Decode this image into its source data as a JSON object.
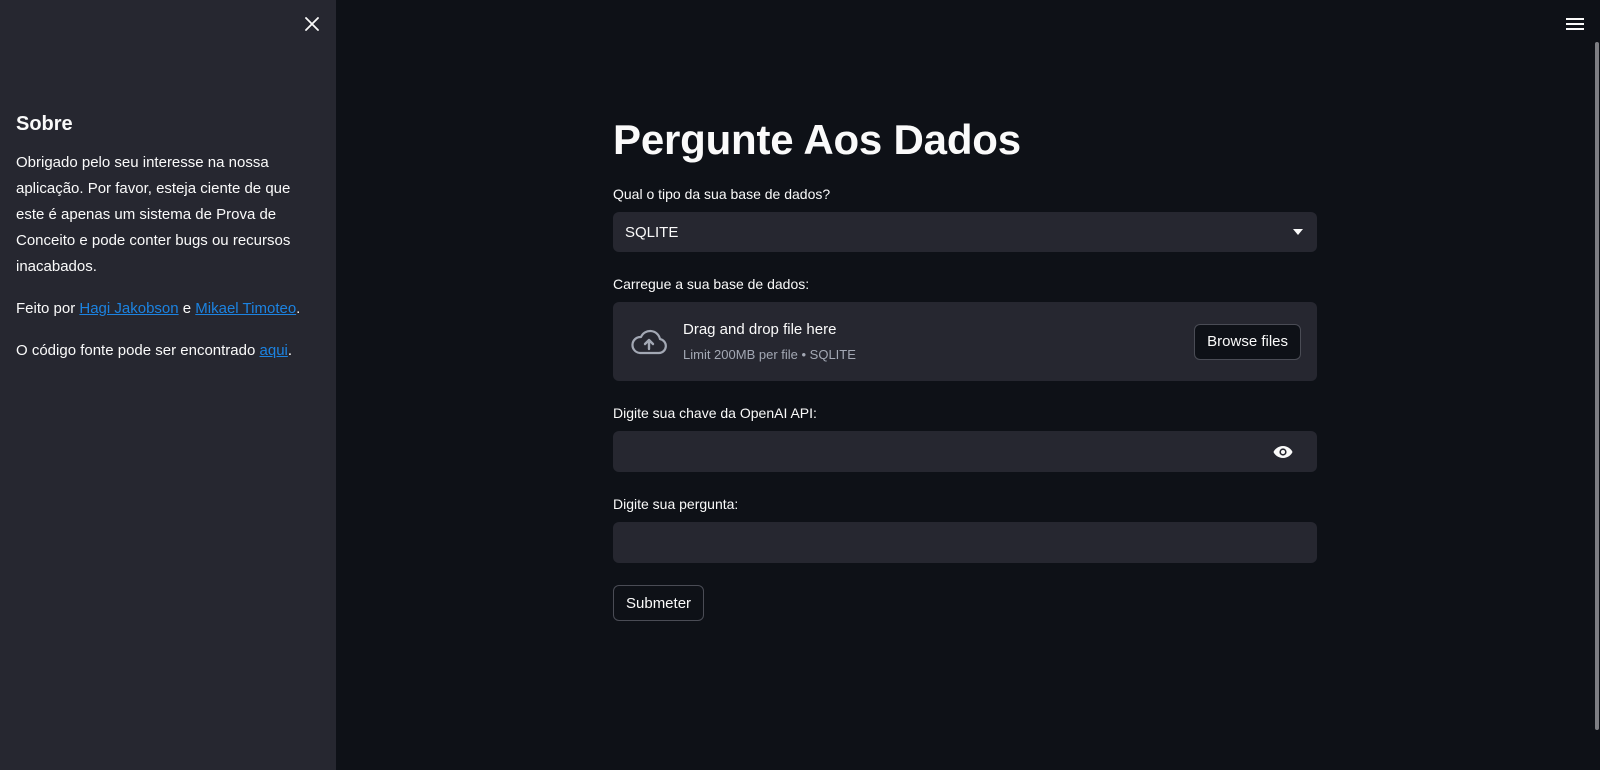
{
  "sidebar": {
    "close_icon": "close-icon",
    "heading": "Sobre",
    "paragraph1": "Obrigado pelo seu interesse na nossa aplicação. Por favor, esteja ciente de que este é apenas um sistema de Prova de Conceito e pode conter bugs ou recursos inacabados.",
    "made_by_prefix": "Feito por ",
    "author1": "Hagi Jakobson",
    "made_by_joiner": " e ",
    "author2": "Mikael Timoteo",
    "made_by_suffix": ".",
    "source_prefix": "O código fonte pode ser encontrado ",
    "source_link": "aqui",
    "source_suffix": "."
  },
  "header": {
    "menu_icon": "hamburger-menu-icon"
  },
  "main": {
    "title": "Pergunte Aos Dados",
    "db_type": {
      "label": "Qual o tipo da sua base de dados?",
      "selected": "SQLITE"
    },
    "upload": {
      "label": "Carregue a sua base de dados:",
      "drag_text": "Drag and drop file here",
      "limit_text": "Limit 200MB per file • SQLITE",
      "browse_label": "Browse files"
    },
    "api_key": {
      "label": "Digite sua chave da OpenAI API:",
      "value": ""
    },
    "question": {
      "label": "Digite sua pergunta:",
      "value": ""
    },
    "submit_label": "Submeter"
  },
  "colors": {
    "background": "#0e1117",
    "sidebar": "#262730",
    "link": "#1c83e1",
    "text": "#fafafa"
  }
}
